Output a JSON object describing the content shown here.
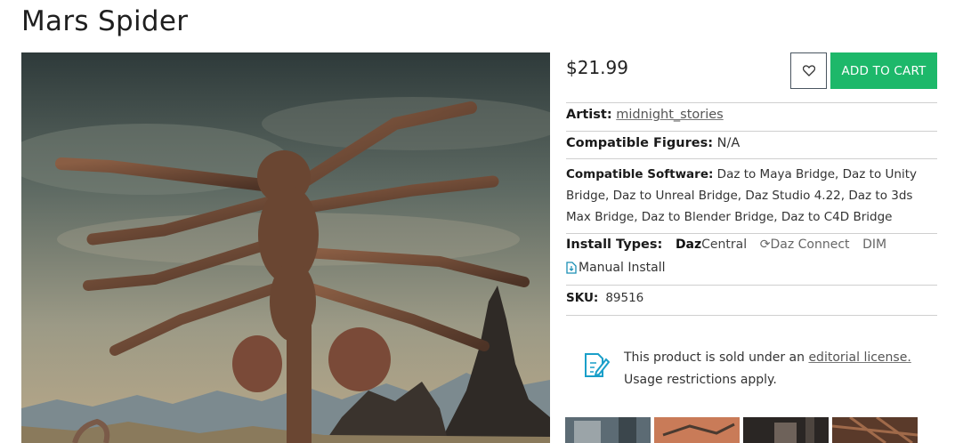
{
  "product": {
    "title": "Mars Spider",
    "price": "$21.99",
    "hero_image": "mars-spider-render"
  },
  "actions": {
    "wishlist_icon": "heart-icon",
    "add_to_cart": "ADD TO CART",
    "cart_color": "#1db86a"
  },
  "details": {
    "artist_label": "Artist:",
    "artist_value": "midnight_stories",
    "figures_label": "Compatible Figures:",
    "figures_value": "N/A",
    "software_label": "Compatible Software:",
    "software_value": "Daz to Maya Bridge, Daz to Unity Bridge, Daz to Unreal Bridge, Daz Studio 4.22, Daz to 3ds Max Bridge, Daz to Blender Bridge, Daz to C4D Bridge",
    "install_label": "Install Types:",
    "install_daz_bold": "Daz",
    "install_daz_light": "Central",
    "install_connect": "Daz Connect",
    "install_dim": "DIM",
    "install_manual": "Manual Install",
    "sku_label": "SKU:",
    "sku_value": "89516"
  },
  "license": {
    "text_prefix": "This product is sold under an",
    "link": "editorial license.",
    "note": "Usage restrictions apply.",
    "icon": "document-edit-icon"
  },
  "thumbnails": [
    "thumb-1",
    "thumb-2",
    "thumb-3",
    "thumb-4"
  ]
}
